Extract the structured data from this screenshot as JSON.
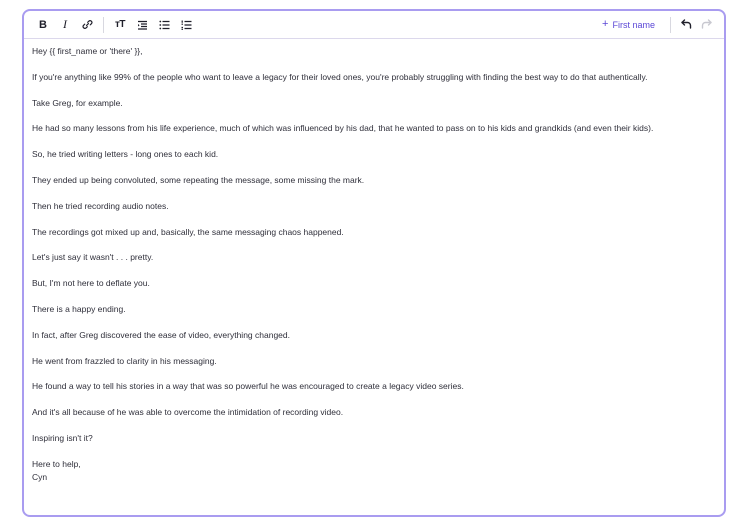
{
  "toolbar": {
    "bold_label": "B",
    "italic_label": "I",
    "text_size_label": "тT",
    "insert_label": "First name",
    "icons": [
      "bold-icon",
      "italic-icon",
      "link-icon",
      "text-size-icon",
      "align-icon",
      "bullet-list-icon",
      "numbered-list-icon",
      "plus-icon",
      "undo-icon",
      "redo-icon"
    ]
  },
  "colors": {
    "accent": "#5b47d6",
    "border": "#a99cf0"
  },
  "message": {
    "lines": [
      "Hey {{ first_name or 'there' }},",
      "If you're anything like 99% of the people who want to leave a legacy for their loved ones, you're probably struggling with finding the best way to do that authentically.",
      "Take Greg, for example.",
      "He had so many lessons from his life experience, much of which was influenced by his dad, that he wanted to pass on to his kids and grandkids (and even their kids).",
      "So, he tried writing letters - long ones to each kid.",
      "They ended up being convoluted, some repeating the message, some missing the mark.",
      "Then he tried recording audio notes.",
      "The recordings got mixed up and, basically, the same messaging chaos happened.",
      "Let's just say it wasn't . . . pretty.",
      "But, I'm not here to deflate you.",
      "There is a happy ending.",
      "In fact, after Greg discovered the ease of video, everything changed.",
      "He went from frazzled to clarity in his messaging.",
      "He found a way to tell his stories in a way that was so powerful he was encouraged to create a legacy video series.",
      "And it's all because of he was able to overcome the intimidation of recording video.",
      "Inspiring isn't it?"
    ],
    "signoff": "Here to help,",
    "signature": "Cyn"
  }
}
